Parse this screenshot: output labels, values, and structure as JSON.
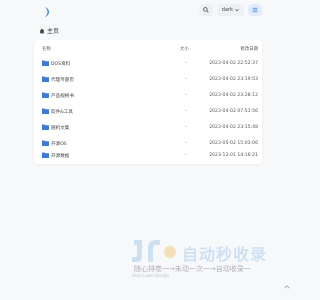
{
  "toolbar": {
    "search_icon": "search-icon",
    "theme_label": "dark",
    "menu_icon": "list-icon"
  },
  "breadcrumb": {
    "home_label": "主页"
  },
  "table": {
    "headers": {
      "name": "名称",
      "size": "大小",
      "modified": "修改日期"
    },
    "rows": [
      {
        "name": "DOS资料",
        "size": "-",
        "modified": "2023-04-02 22:52:37"
      },
      {
        "name": "代理专题页",
        "size": "-",
        "modified": "2023-04-02 23:19:53"
      },
      {
        "name": "产品规格书",
        "size": "-",
        "modified": "2023-04-02 23:28:12"
      },
      {
        "name": "软件&工具",
        "size": "-",
        "modified": "2023-04-02 07:51:56"
      },
      {
        "name": "随机文集",
        "size": "-",
        "modified": "2023-04-02 23:15:48"
      },
      {
        "name": "开源OS",
        "size": "-",
        "modified": "2023-05-02 15:03:06"
      },
      {
        "name": "开源数据",
        "size": "-",
        "modified": "2023-12-01 14:16:21"
      }
    ]
  },
  "watermark": {
    "brand": "自动秒收录",
    "tagline": "随心排卷一→未动一次一→自动收录一",
    "small": "Sean Lavin Design"
  },
  "colors": {
    "accent": "#3d7bd9",
    "folder": "#3d7bd9"
  }
}
